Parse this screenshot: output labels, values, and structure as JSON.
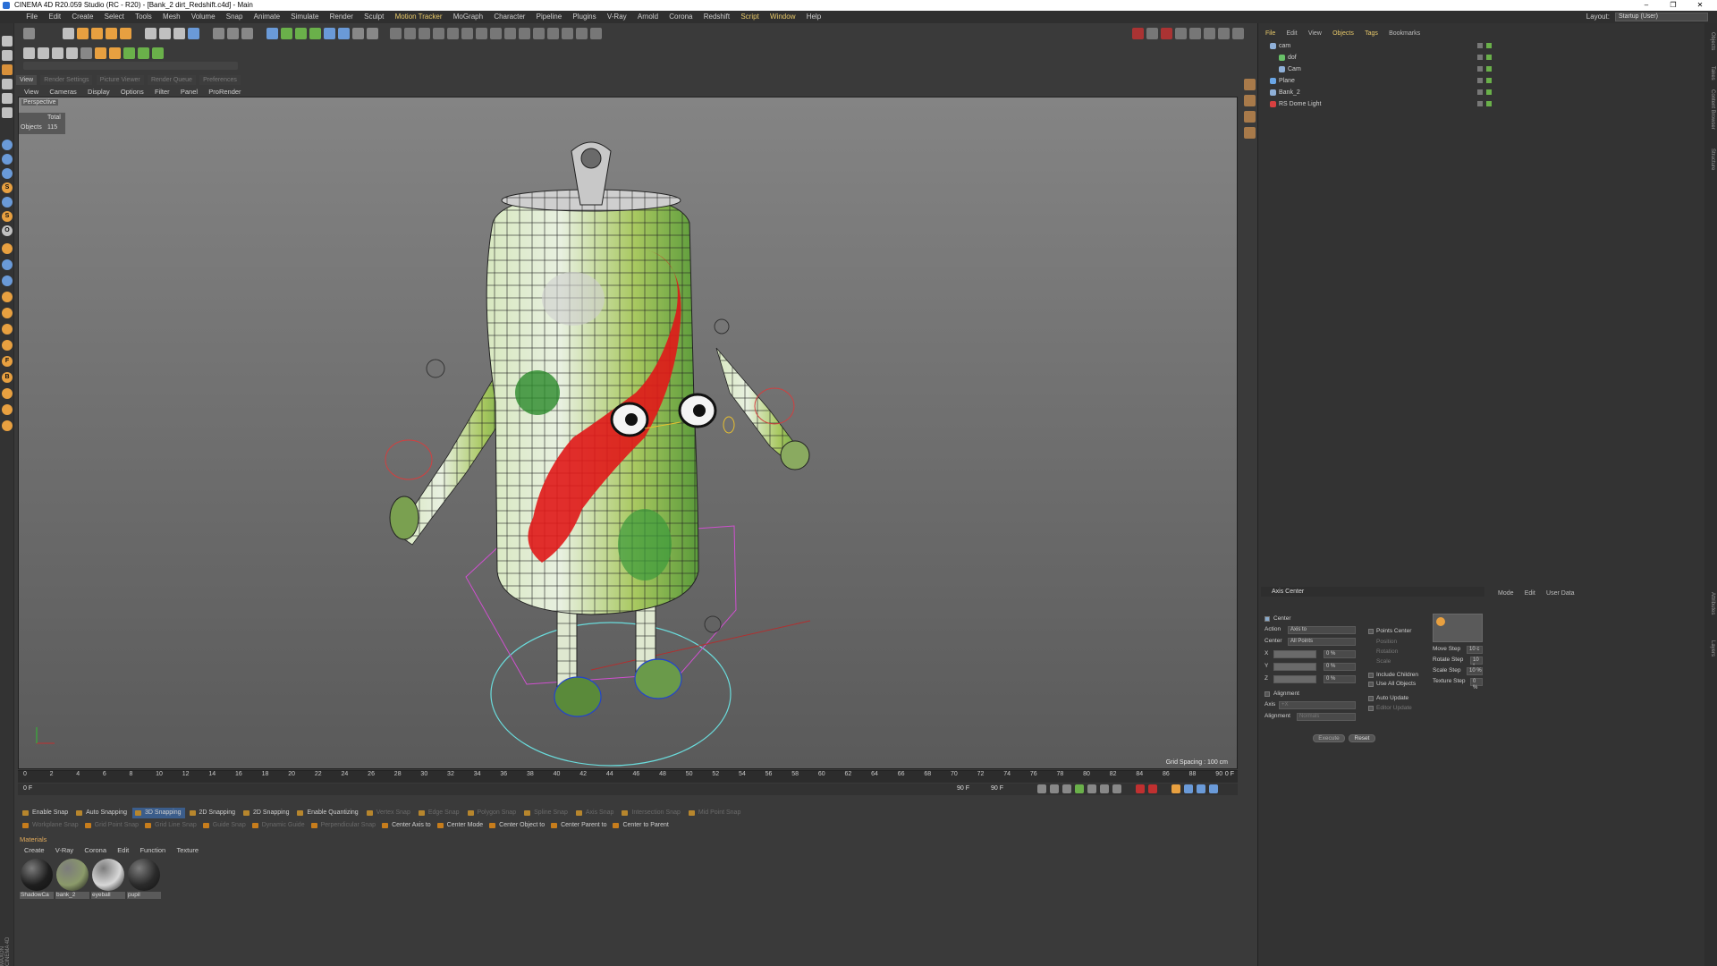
{
  "window": {
    "title": "CINEMA 4D R20.059 Studio (RC - R20) - [Bank_2 dirt_Redshift.c4d] - Main",
    "controls": [
      "–",
      "❐",
      "✕"
    ]
  },
  "menubar": {
    "items": [
      "File",
      "Edit",
      "Create",
      "Select",
      "Tools",
      "Mesh",
      "Volume",
      "Snap",
      "Animate",
      "Simulate",
      "Render",
      "Sculpt",
      "Motion Tracker",
      "MoGraph",
      "Character",
      "Pipeline",
      "Plugins",
      "V-Ray",
      "Arnold",
      "Corona",
      "Redshift",
      "Script",
      "Window",
      "Help"
    ],
    "layout_label": "Layout:",
    "layout_value": "Startup (User)"
  },
  "render_tabs": [
    "View",
    "Render Settings",
    "Picture Viewer",
    "Render Queue",
    "Preferences"
  ],
  "viewport_menu": [
    "View",
    "Cameras",
    "Display",
    "Options",
    "Filter",
    "Panel",
    "ProRender"
  ],
  "viewport": {
    "camera_label": "Perspective",
    "stats_header": "Total",
    "stats_label": "Objects",
    "stats_value": "115",
    "grid_spacing": "Grid Spacing : 100 cm"
  },
  "timeline": {
    "ticks": [
      "0",
      "2",
      "4",
      "6",
      "8",
      "10",
      "12",
      "14",
      "16",
      "18",
      "20",
      "22",
      "24",
      "26",
      "28",
      "30",
      "32",
      "34",
      "36",
      "38",
      "40",
      "42",
      "44",
      "46",
      "48",
      "50",
      "52",
      "54",
      "56",
      "58",
      "60",
      "62",
      "64",
      "66",
      "68",
      "70",
      "72",
      "74",
      "76",
      "78",
      "80",
      "82",
      "84",
      "86",
      "88",
      "90"
    ],
    "frame_end": "0 F",
    "current_frame": "0 F",
    "range_start": "0 F",
    "range_end": "90 F",
    "range_end2": "90 F"
  },
  "snap_bar": {
    "items": [
      {
        "label": "Enable Snap",
        "state": "normal"
      },
      {
        "label": "Auto Snapping",
        "state": "normal"
      },
      {
        "label": "3D Snapping",
        "state": "active"
      },
      {
        "label": "2D Snapping",
        "state": "normal"
      },
      {
        "label": "2D Snapping",
        "state": "normal"
      },
      {
        "label": "Enable Quantizing",
        "state": "normal"
      },
      {
        "label": "Vertex Snap",
        "state": "dim"
      },
      {
        "label": "Edge Snap",
        "state": "dim"
      },
      {
        "label": "Polygon Snap",
        "state": "dim"
      },
      {
        "label": "Spline Snap",
        "state": "dim"
      },
      {
        "label": "Axis Snap",
        "state": "dim"
      },
      {
        "label": "Intersection Snap",
        "state": "dim"
      },
      {
        "label": "Mid Point Snap",
        "state": "dim"
      }
    ],
    "row2": [
      {
        "label": "Workplane Snap",
        "state": "dim"
      },
      {
        "label": "Grid Point Snap",
        "state": "dim"
      },
      {
        "label": "Grid Line Snap",
        "state": "dim"
      },
      {
        "label": "Guide Snap",
        "state": "dim"
      },
      {
        "label": "Dynamic Guide",
        "state": "dim"
      },
      {
        "label": "Perpendicular Snap",
        "state": "dim"
      },
      {
        "label": "Center Axis to",
        "state": "normal"
      },
      {
        "label": "Center Mode",
        "state": "normal"
      },
      {
        "label": "Center Object to",
        "state": "normal"
      },
      {
        "label": "Center Parent to",
        "state": "normal"
      },
      {
        "label": "Center to Parent",
        "state": "normal"
      }
    ]
  },
  "materials": {
    "title": "Materials",
    "menu": [
      "Create",
      "V-Ray",
      "Corona",
      "Edit",
      "Function",
      "Texture"
    ],
    "items": [
      {
        "label": "ShadowCa",
        "color": "#1e1e1e"
      },
      {
        "label": "bank_2",
        "color": "#8b9a6a"
      },
      {
        "label": "eyeball",
        "color": "#d8d8d8"
      },
      {
        "label": "pupil",
        "color": "#2a2a2a"
      }
    ]
  },
  "objects_panel": {
    "menu": [
      "File",
      "Edit",
      "View",
      "Objects",
      "Tags",
      "Bookmarks"
    ],
    "rows": [
      {
        "name": "cam",
        "indent": 0,
        "icon_color": "#8fb0d8"
      },
      {
        "name": "dof",
        "indent": 1,
        "icon_color": "#68c068"
      },
      {
        "name": "Cam",
        "indent": 1,
        "icon_color": "#8fb0d8"
      },
      {
        "name": "Plane",
        "indent": 0,
        "icon_color": "#6aa6e6"
      },
      {
        "name": "Bank_2",
        "indent": 0,
        "icon_color": "#8fb0d8"
      },
      {
        "name": "RS Dome Light",
        "indent": 0,
        "icon_color": "#d84040"
      }
    ]
  },
  "attributes_panel": {
    "header": "Axis Center",
    "menu": [
      "Mode",
      "Edit",
      "User Data"
    ],
    "center_label": "Center",
    "action_label": "Action",
    "action_value": "Axis to",
    "center_select_label": "Center",
    "center_select_value": "All Points",
    "x_label": "X",
    "y_label": "Y",
    "z_label": "Z",
    "x_value": "0 %",
    "y_value": "0 %",
    "z_value": "0 %",
    "points_center": "Points Center",
    "position": "Position",
    "rotation": "Rotation",
    "scale": "Scale",
    "include_children": "Include Children",
    "use_all_objects": "Use All Objects",
    "alignment": "Alignment",
    "axis_label": "Axis",
    "axis_value": "+X",
    "alignment_label": "Alignment",
    "alignment_value": "Normals",
    "auto_update": "Auto Update",
    "editor_update": "Editor Update",
    "execute": "Execute",
    "reset": "Reset",
    "move_step": "Move Step",
    "move_step_val": "10 c",
    "rotate_step": "Rotate Step",
    "rotate_step_val": "10 °",
    "scale_step": "Scale Step",
    "scale_step_val": "10 %",
    "texture_step": "Texture Step",
    "texture_step_val": "0 %"
  },
  "right_tabs": [
    "Objects",
    "Takes",
    "Content Browser",
    "Structure",
    "Attributes",
    "Layers"
  ],
  "brand": "MAXON CINEMA 4D",
  "colors": {
    "accent_yellow": "#e8c96a",
    "snap_active": "#3b5d8b",
    "material_title": "#e0a95a"
  }
}
